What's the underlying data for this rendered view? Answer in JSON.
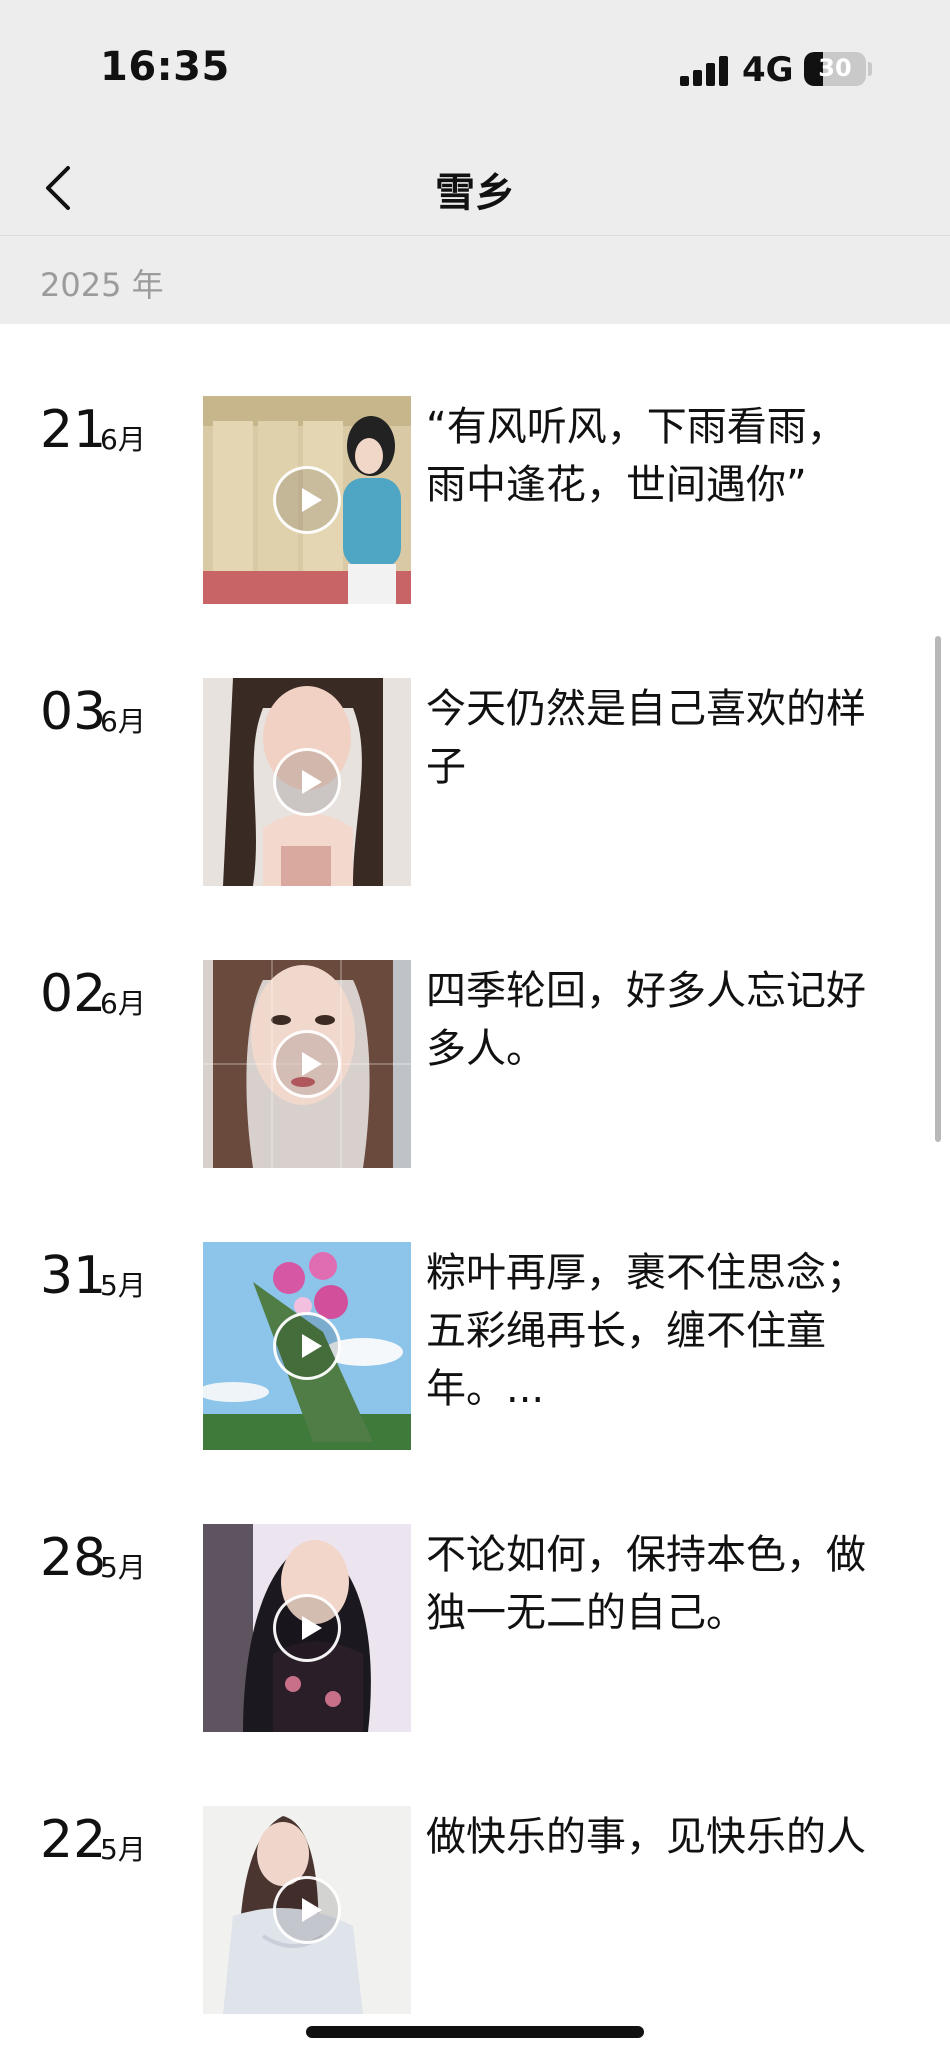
{
  "status_bar": {
    "time": "16:35",
    "network": "4G",
    "battery": "30",
    "battery_level": 0.3
  },
  "nav": {
    "title": "雪乡",
    "back_icon": "chevron-left-icon"
  },
  "year": "2025 年",
  "posts": [
    {
      "day": "21",
      "month": "6月",
      "caption": "“有风听风，下雨看雨，雨中逢花，世间遇你”"
    },
    {
      "day": "03",
      "month": "6月",
      "caption": "今天仍然是自己喜欢的样子"
    },
    {
      "day": "02",
      "month": "6月",
      "caption": "四季轮回，好多人忘记好多人。"
    },
    {
      "day": "31",
      "month": "5月",
      "caption": "粽叶再厚，裹不住思念；五彩绳再长，缠不住童年。..."
    },
    {
      "day": "28",
      "month": "5月",
      "caption": "不论如何，保持本色，做独一无二的自己。"
    },
    {
      "day": "22",
      "month": "5月",
      "caption": "做快乐的事，见快乐的人"
    }
  ]
}
